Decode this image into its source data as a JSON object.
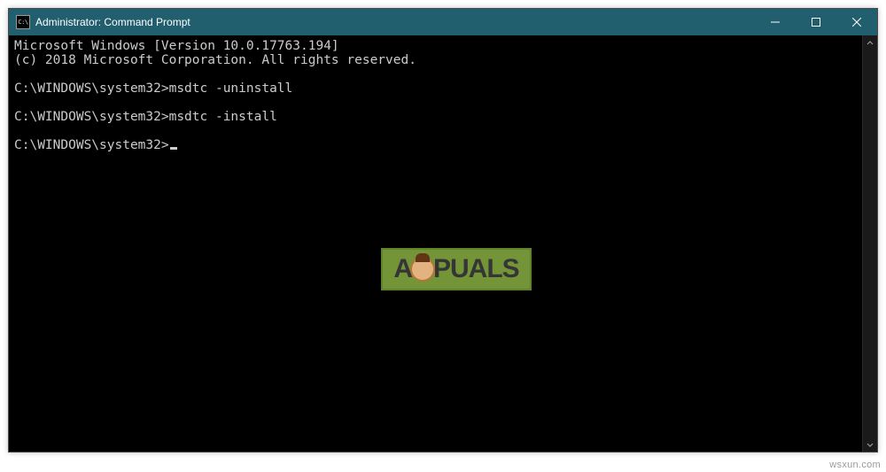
{
  "window": {
    "title": "Administrator: Command Prompt",
    "icon_text": "C:\\"
  },
  "controls": {
    "minimize": "minimize",
    "maximize": "maximize",
    "close": "close"
  },
  "terminal": {
    "lines": [
      "Microsoft Windows [Version 10.0.17763.194]",
      "(c) 2018 Microsoft Corporation. All rights reserved.",
      "",
      "C:\\WINDOWS\\system32>msdtc -uninstall",
      "",
      "C:\\WINDOWS\\system32>msdtc -install",
      "",
      "C:\\WINDOWS\\system32>"
    ],
    "cursor_line_index": 7
  },
  "watermark": {
    "prefix": "A",
    "suffix": "PUALS"
  },
  "credit": "wsxun.com"
}
